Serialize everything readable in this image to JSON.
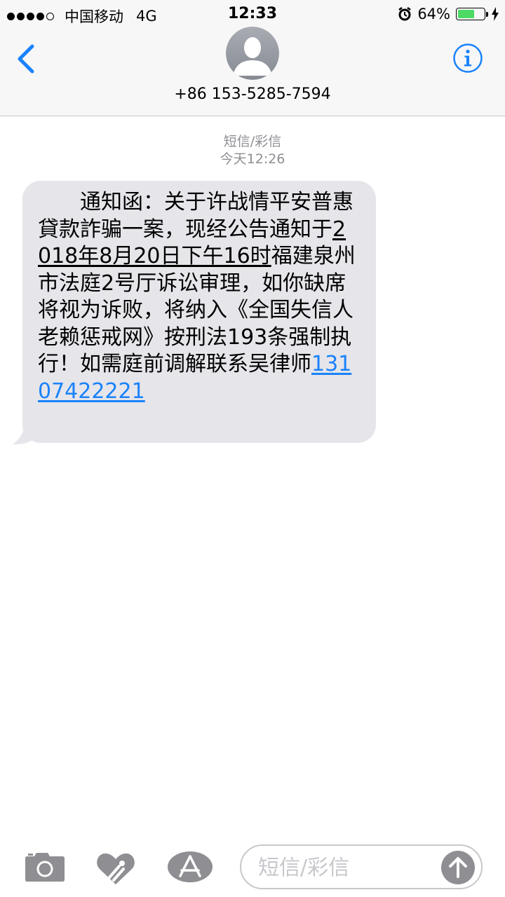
{
  "status_bar": {
    "carrier": "中国移动",
    "network": "4G",
    "time": "12:33",
    "battery_percent_label": "64%",
    "battery_level": 0.64
  },
  "header": {
    "contact_number": "+86 153-5285-7594"
  },
  "conversation": {
    "service_label": "短信/彩信",
    "timestamp": "今天12:26",
    "message": {
      "part1": "通知函：关于许战情平安普惠貸款詐骗一案，现经公告通知于",
      "date_text": "2018年8月20日下午16时",
      "part2": "福建泉州市法庭2号厅诉讼审理，如你缺席将视为诉败，将纳入《全国失信人老赖惩戒网》按刑法193条强制执行！如需庭前调解联系吴律师",
      "phone_link": "13107422221"
    }
  },
  "composer": {
    "placeholder": "短信/彩信"
  },
  "colors": {
    "accent": "#1a82fb",
    "bubble": "#e5e5ea",
    "icon_gray": "#8e8e93",
    "battery": "#4cd964"
  },
  "icons": {
    "back": "chevron-left-icon",
    "info": "info-icon",
    "avatar": "person-silhouette-icon",
    "camera": "camera-icon",
    "digital_touch": "heart-hands-icon",
    "apps": "app-store-icon",
    "send": "arrow-up-icon"
  }
}
